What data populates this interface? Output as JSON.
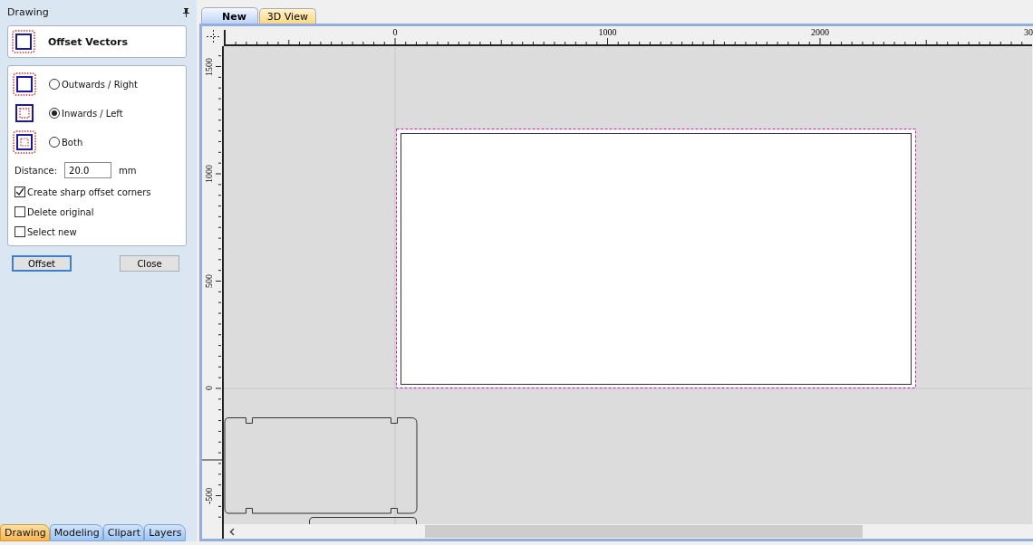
{
  "panel": {
    "title": "Drawing",
    "tool_title": "Offset Vectors",
    "directions": [
      {
        "label": "Outwards / Right",
        "kind": "outwards",
        "selected": false
      },
      {
        "label": "Inwards / Left",
        "kind": "inwards",
        "selected": true
      },
      {
        "label": "Both",
        "kind": "both",
        "selected": false
      }
    ],
    "distance": {
      "label": "Distance:",
      "value": "20.0",
      "unit": "mm"
    },
    "options": [
      {
        "label": "Create sharp offset corners",
        "checked": true
      },
      {
        "label": "Delete original",
        "checked": false
      },
      {
        "label": "Select new",
        "checked": false
      }
    ],
    "buttons": [
      {
        "label": "Offset",
        "focused": true
      },
      {
        "label": "Close",
        "focused": false
      }
    ]
  },
  "bottom_tabs": [
    {
      "label": "Drawing",
      "selected": true
    },
    {
      "label": "Modeling",
      "selected": false
    },
    {
      "label": "Clipart",
      "selected": false
    },
    {
      "label": "Layers",
      "selected": false
    }
  ],
  "document_tabs": [
    {
      "label": "New",
      "selected": true
    },
    {
      "label": "3D View",
      "selected": false
    }
  ],
  "rulers": {
    "horizontal": [
      "0",
      "1000",
      "2000",
      "30"
    ],
    "vertical": [
      "1500",
      "1000",
      "500",
      "0",
      "-500"
    ]
  }
}
